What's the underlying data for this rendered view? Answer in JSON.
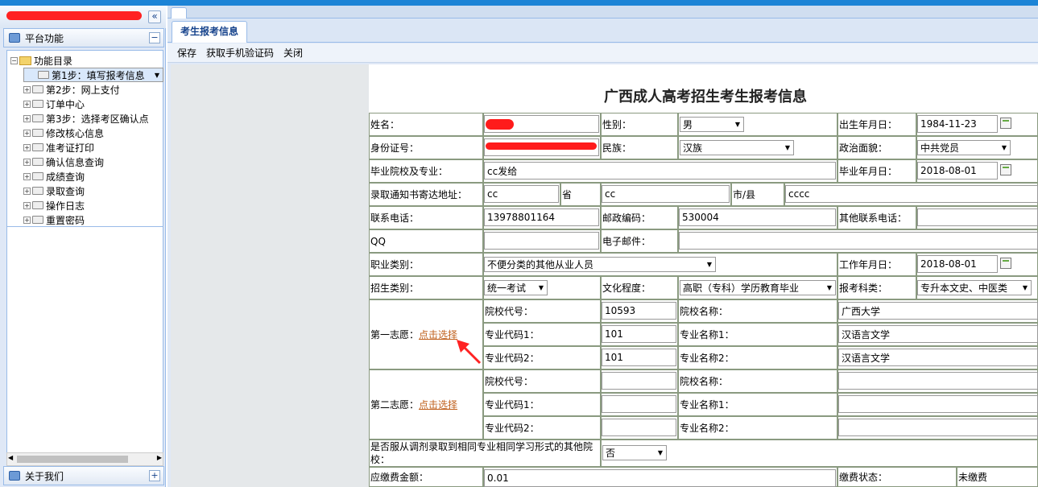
{
  "sidebar": {
    "header_label": "平台功能",
    "header_btn": "−",
    "collapse_btn": "«",
    "footer_label": "关于我们",
    "footer_btn": "+",
    "tree_root": "功能目录",
    "items": [
      {
        "label": "第1步：填写报考信息"
      },
      {
        "label": "第2步：网上支付"
      },
      {
        "label": "订单中心"
      },
      {
        "label": "第3步：选择考区确认点"
      },
      {
        "label": "修改核心信息"
      },
      {
        "label": "准考证打印"
      },
      {
        "label": "确认信息查询"
      },
      {
        "label": "成绩查询"
      },
      {
        "label": "录取查询"
      },
      {
        "label": "操作日志"
      },
      {
        "label": "重置密码"
      }
    ]
  },
  "tabs": {
    "active": "考生报考信息"
  },
  "toolbar": {
    "save": "保存",
    "sms": "获取手机验证码",
    "close": "关闭"
  },
  "form": {
    "title": "广西成人高考招生考生报考信息",
    "name_label": "姓名：",
    "gender_label": "性别：",
    "gender": "男",
    "birth_label": "出生年月日：",
    "birth": "1984-11-23",
    "id_label": "身份证号：",
    "ethnic_label": "民族：",
    "ethnic": "汉族",
    "political_label": "政治面貌：",
    "political": "中共党员",
    "school_label": "毕业院校及专业：",
    "school": "cc发给",
    "gradyear_label": "毕业年月日：",
    "gradyear": "2018-08-01",
    "addr_label": "录取通知书寄达地址：",
    "addr1": "cc",
    "prov_label": "省",
    "addr2": "cc",
    "city_label": "市/县",
    "addr3": "cccc",
    "phone_label": "联系电话：",
    "phone": "13978801164",
    "postal_label": "邮政编码：",
    "postal": "530004",
    "otherphone_label": "其他联系电话：",
    "qq_label": "QQ",
    "email_label": "电子邮件：",
    "job_label": "职业类别：",
    "job": "不便分类的其他从业人员",
    "workyear_label": "工作年月日：",
    "workyear": "2018-08-01",
    "enroll_label": "招生类别：",
    "enroll": "统一考试",
    "edu_label": "文化程度：",
    "edu": "高职（专科）学历教育毕业",
    "subject_label": "报考科类：",
    "subject": "专升本文史、中医类",
    "choice1_label": "第一志愿：",
    "choice_link": "点击选择",
    "choice2_label": "第二志愿：",
    "school_code_label": "院校代号：",
    "school_name_label": "院校名称：",
    "major_code1_label": "专业代码1：",
    "major_name1_label": "专业名称1：",
    "major_code2_label": "专业代码2：",
    "major_name2_label": "专业名称2：",
    "c1_school_code": "10593",
    "c1_school_name": "广西大学",
    "c1_major_code1": "101",
    "c1_major_name1": "汉语言文学",
    "c1_major_code2": "101",
    "c1_major_name2": "汉语言文学",
    "adjust_label": "是否服从调剂录取到相同专业相同学习形式的其他院校：",
    "adjust": "否",
    "fee_label": "应缴费金额：",
    "fee": "0.01",
    "paystatus_label": "缴费状态：",
    "paystatus": "未缴费"
  },
  "colors": {
    "topbar": "#1c84d6",
    "panel_bg": "#dfe8f6",
    "link": "#c0611e",
    "annotation": "#ff1b1b"
  }
}
